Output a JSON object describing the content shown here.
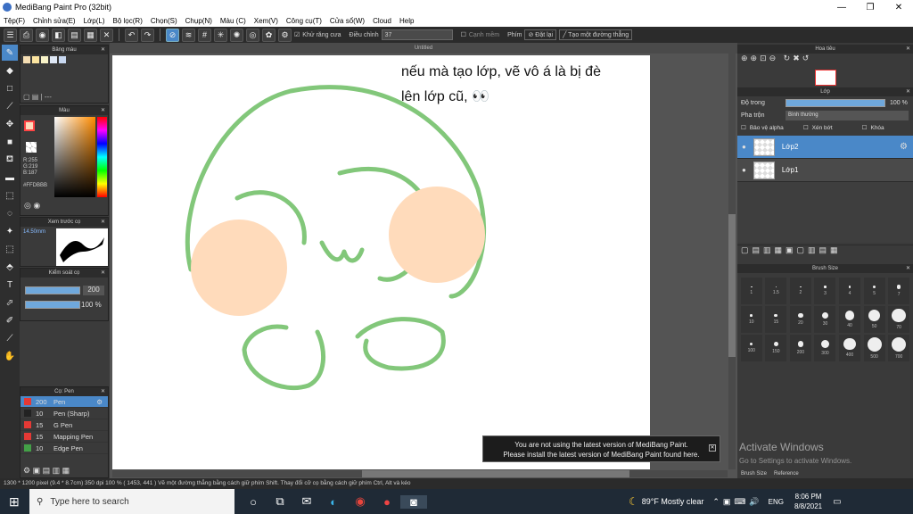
{
  "window": {
    "title": "MediBang Paint Pro (32bit)",
    "minimize": "—",
    "restore": "❐",
    "close": "✕"
  },
  "menu": [
    "Tệp(F)",
    "Chỉnh sửa(E)",
    "Lớp(L)",
    "Bộ lọc(R)",
    "Chọn(S)",
    "Chụp(N)",
    "Màu (C)",
    "Xem(V)",
    "Công cụ(T)",
    "Cửa sổ(W)",
    "Cloud",
    "Help"
  ],
  "toolbar": {
    "antialias_label": "Khử răng cưa",
    "adjust_label": "Điều chỉnh",
    "adjust_value": "37",
    "smooth_label": "Cạnh mềm",
    "key_label": "Phím",
    "ruler_label": "Đặt lại",
    "line_label": "Tạo một đường thẳng"
  },
  "palette_panel": {
    "title": "Bảng màu",
    "dash_text": "| ---",
    "swatches": [
      "#f5deb3",
      "#fbe4a0",
      "#f8f3c8",
      "#dfe8f5",
      "#c8d8f0"
    ]
  },
  "color_panel": {
    "title": "Màu",
    "rgb": "R:255\nG:219\nB:187",
    "hex": "#FFDBBB",
    "foreground": "#ffdbbb",
    "background": "#ffffff"
  },
  "preview_panel": {
    "title": "Xem trước cọ",
    "size": "14.50mm"
  },
  "control_panel": {
    "title": "Kiểm soát cọ",
    "size_value": "200",
    "opacity_value": "100 %"
  },
  "brush_panel": {
    "title": "Cọ: Pen",
    "items": [
      {
        "size": "200",
        "name": "Pen",
        "color": "#e53935",
        "selected": true
      },
      {
        "size": "10",
        "name": "Pen (Sharp)",
        "color": "#222222",
        "selected": false
      },
      {
        "size": "15",
        "name": "G Pen",
        "color": "#e53935",
        "selected": false
      },
      {
        "size": "15",
        "name": "Mapping Pen",
        "color": "#e53935",
        "selected": false
      },
      {
        "size": "10",
        "name": "Edge Pen",
        "color": "#43a047",
        "selected": false
      }
    ]
  },
  "canvas": {
    "tab": "Untitled",
    "note_line1": "nếu mà tạo lớp, vẽ vô á là bị đè",
    "note_line2": "lên lớp cũ, 👀",
    "stroke_color": "#82c77a",
    "cheek_color": "#ffdbbb"
  },
  "navigator": {
    "title": "Hoa tiêu"
  },
  "layer_panel": {
    "title": "Lớp",
    "opacity_label": "Độ trong",
    "opacity_value": "100 %",
    "blend_label": "Pha trộn",
    "blend_value": "Bình thường",
    "protect_alpha": "Bảo vệ alpha",
    "clipping": "Xén bớt",
    "lock": "Khóa",
    "layers": [
      {
        "name": "Lớp2",
        "selected": true
      },
      {
        "name": "Lớp1",
        "selected": false
      }
    ]
  },
  "brush_size_panel": {
    "title": "Brush Size",
    "row1": [
      "1",
      "1.5",
      "2",
      "3",
      "4",
      "5",
      "7"
    ],
    "row2": [
      "10",
      "15",
      "20",
      "30",
      "40",
      "50",
      "70"
    ],
    "row3": [
      "100",
      "150",
      "200",
      "300",
      "400",
      "500",
      "700"
    ],
    "tabs": [
      "Brush Size",
      "Reference"
    ]
  },
  "notice": {
    "line1": "You are not using the latest version of MediBang Paint.",
    "line2": "Please install the latest version of MediBang Paint found here."
  },
  "watermark": {
    "line1": "Activate Windows",
    "line2": "Go to Settings to activate Windows."
  },
  "status": "1300 * 1200 pixel   (9.4 * 8.7cm)   350 dpi   100 %   ( 1453, 441 )   Vẽ một đường thẳng bằng cách giữ phím Shift. Thay đổi cỡ cọ bằng cách giữ phím Ctrl, Alt và kéo",
  "taskbar": {
    "search_placeholder": "Type here to search",
    "weather": "89°F  Mostly clear",
    "lang": "ENG",
    "time": "8:06 PM",
    "date": "8/8/2021"
  }
}
